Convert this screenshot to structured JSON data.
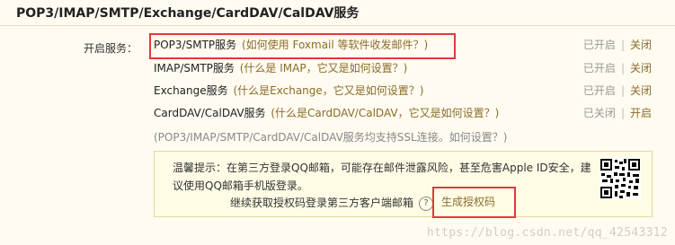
{
  "section": {
    "title": "POP3/IMAP/SMTP/Exchange/CardDAV/CalDAV服务"
  },
  "services_label": "开启服务：",
  "services": [
    {
      "name": "POP3/SMTP服务",
      "link": "(如何使用 Foxmail 等软件收发邮件？)",
      "state": "已开启",
      "action": "关闭"
    },
    {
      "name": "IMAP/SMTP服务",
      "link": "(什么是 IMAP，它又是如何设置？)",
      "state": "已开启",
      "action": "关闭"
    },
    {
      "name": "Exchange服务",
      "link": "(什么是Exchange，它又是如何设置？)",
      "state": "已开启",
      "action": "关闭"
    },
    {
      "name": "CardDAV/CalDAV服务",
      "link": "(什么是CardDAV/CalDAV，它又是如何设置？)",
      "state": "已关闭",
      "action": "开启"
    }
  ],
  "ssl_note": "(POP3/IMAP/SMTP/CardDAV/CalDAV服务均支持SSL连接。如何设置？)",
  "hint": {
    "text": "温馨提示：在第三方登录QQ邮箱，可能存在邮件泄露风险，甚至危害Apple ID安全，建议使用QQ邮箱手机版登录。",
    "continue_text": "继续获取授权码登录第三方客户端邮箱",
    "help_glyph": "?",
    "generate_label": "生成授权码"
  },
  "watermark": "https://blog.csdn.net/qq_42543312",
  "colors": {
    "highlight": "#e03a3a",
    "link": "#8a6c2a",
    "background": "#fffbf0"
  }
}
